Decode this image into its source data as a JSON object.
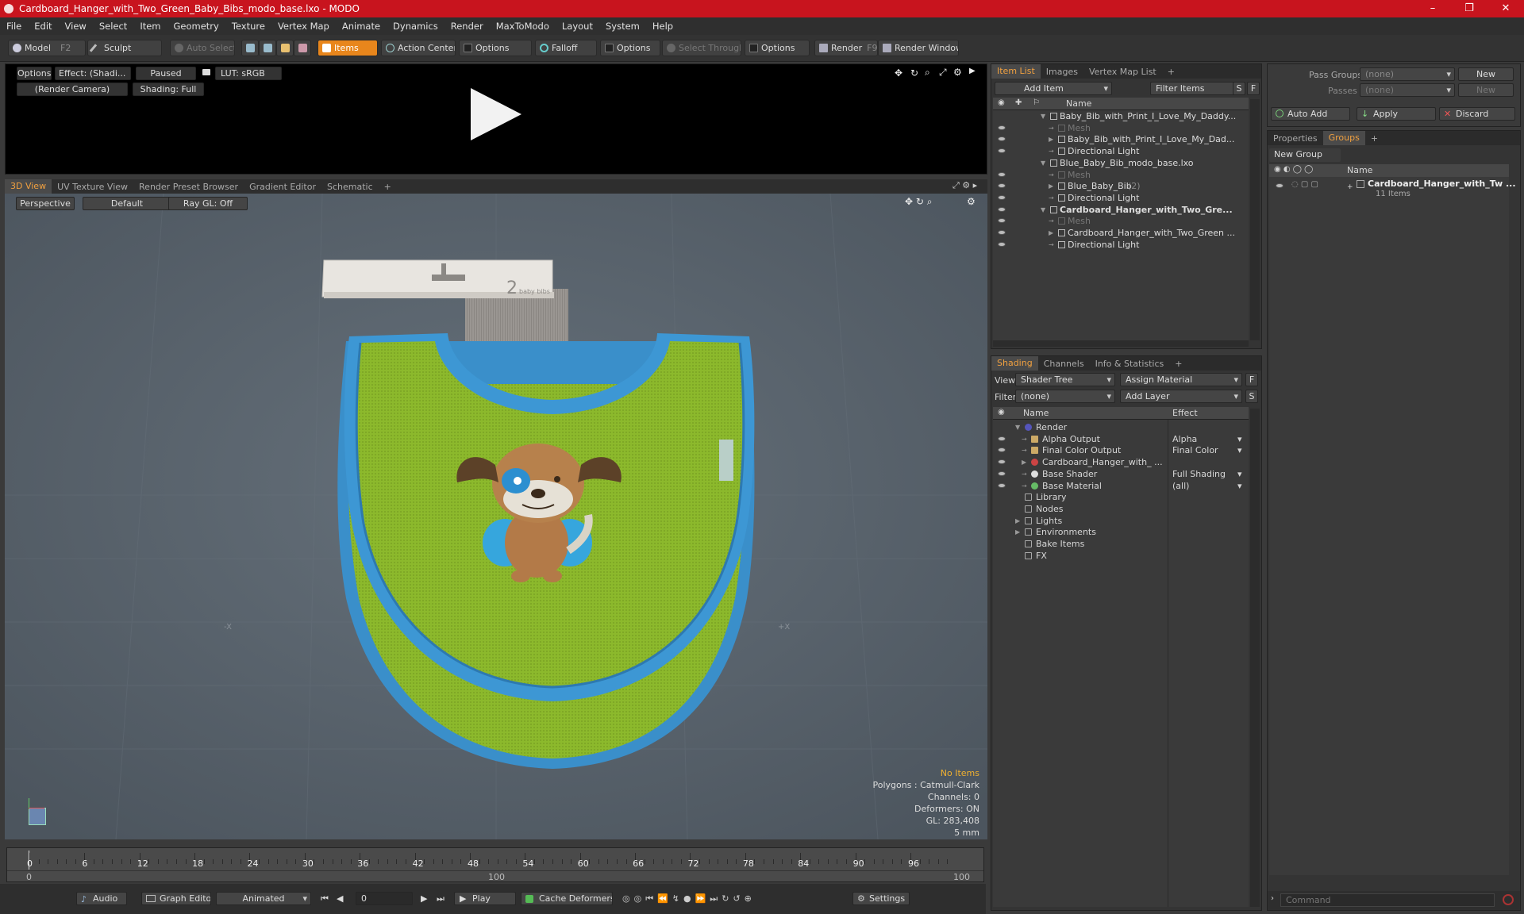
{
  "window": {
    "title": "Cardboard_Hanger_with_Two_Green_Baby_Bibs_modo_base.lxo - MODO",
    "min": "–",
    "max": "❐",
    "close": "✕"
  },
  "menu": [
    "File",
    "Edit",
    "View",
    "Select",
    "Item",
    "Geometry",
    "Texture",
    "Vertex Map",
    "Animate",
    "Dynamics",
    "Render",
    "MaxToModo",
    "Layout",
    "System",
    "Help"
  ],
  "toolbar": {
    "model": "Model",
    "model_key": "F2",
    "sculpt": "Sculpt",
    "auto_select": "Auto Select",
    "items": "Items",
    "action_center": "Action Center",
    "options1": "Options",
    "falloff": "Falloff",
    "options2": "Options",
    "select_through": "Select Through",
    "options3": "Options",
    "render": "Render",
    "render_key": "F9",
    "render_window": "Render Window"
  },
  "preview": {
    "options": "Options",
    "effect": "Effect: (Shadi...",
    "paused": "Paused",
    "lut": "LUT: sRGB",
    "camera": "(Render Camera)",
    "shading": "Shading: Full"
  },
  "viewport_tabs": [
    "3D View",
    "UV Texture View",
    "Render Preset Browser",
    "Gradient Editor",
    "Schematic",
    "+"
  ],
  "viewport": {
    "perspective": "Perspective",
    "default": "Default",
    "raygl": "Ray GL: Off",
    "hanger_text_num": "2",
    "hanger_text": "baby bibs",
    "axis_neg": "-X",
    "axis_pos": "+X",
    "info": {
      "no_items": "No Items",
      "polygons": "Polygons : Catmull-Clark",
      "channels": "Channels: 0",
      "deformers": "Deformers: ON",
      "gl": "GL: 283,408",
      "scale": "5 mm"
    }
  },
  "timeline": {
    "ticks": [
      "0",
      "6",
      "12",
      "18",
      "24",
      "30",
      "36",
      "42",
      "48",
      "54",
      "60",
      "66",
      "72",
      "78",
      "84",
      "90",
      "96"
    ],
    "sub_left": "0",
    "sub_mid": "100",
    "sub_right": "100"
  },
  "bottom": {
    "audio": "Audio",
    "graph_editor": "Graph Editor",
    "animated": "Animated",
    "frame": "0",
    "play": "Play",
    "cache": "Cache Deformers",
    "settings": "Settings"
  },
  "itemlist": {
    "tabs": [
      "Item List",
      "Images",
      "Vertex Map List",
      "+"
    ],
    "add_item": "Add Item",
    "filter_items": "Filter Items",
    "s": "S",
    "f": "F",
    "col_name": "Name",
    "rows": [
      {
        "label": "Baby_Bib_with_Print_I_Love_My_Daddy...",
        "bold": false,
        "dim": false,
        "indent": 0,
        "arrow": "▼"
      },
      {
        "label": "Mesh",
        "bold": false,
        "dim": true,
        "indent": 1,
        "arrow": ""
      },
      {
        "label": "Baby_Bib_with_Print_I_Love_My_Dad...",
        "bold": false,
        "dim": false,
        "indent": 1,
        "arrow": "▶"
      },
      {
        "label": "Directional Light",
        "bold": false,
        "dim": false,
        "indent": 1,
        "arrow": ""
      },
      {
        "label": "Blue_Baby_Bib_modo_base.lxo",
        "bold": false,
        "dim": false,
        "indent": 0,
        "arrow": "▼"
      },
      {
        "label": "Mesh",
        "bold": false,
        "dim": true,
        "indent": 1,
        "arrow": ""
      },
      {
        "label": "Blue_Baby_Bib",
        "suffix": "(2)",
        "bold": false,
        "dim": false,
        "indent": 1,
        "arrow": "▶"
      },
      {
        "label": "Directional Light",
        "bold": false,
        "dim": false,
        "indent": 1,
        "arrow": ""
      },
      {
        "label": "Cardboard_Hanger_with_Two_Gre...",
        "bold": true,
        "dim": false,
        "indent": 0,
        "arrow": "▼"
      },
      {
        "label": "Mesh",
        "bold": false,
        "dim": true,
        "indent": 1,
        "arrow": ""
      },
      {
        "label": "Cardboard_Hanger_with_Two_Green ...",
        "bold": false,
        "dim": false,
        "indent": 1,
        "arrow": "▶"
      },
      {
        "label": "Directional Light",
        "bold": false,
        "dim": false,
        "indent": 1,
        "arrow": ""
      }
    ]
  },
  "shading": {
    "tabs": [
      "Shading",
      "Channels",
      "Info & Statistics",
      "+"
    ],
    "view_label": "View",
    "view_value": "Shader Tree",
    "assign_material": "Assign Material",
    "f": "F",
    "filter_label": "Filter",
    "filter_value": "(none)",
    "add_layer": "Add Layer",
    "s": "S",
    "col_name": "Name",
    "col_effect": "Effect",
    "rows": [
      {
        "label": "Render",
        "effect": "",
        "indent": 0,
        "arrow": "▼",
        "eye": false
      },
      {
        "label": "Alpha Output",
        "effect": "Alpha",
        "indent": 1,
        "arrow": "",
        "eye": true
      },
      {
        "label": "Final Color Output",
        "effect": "Final Color",
        "indent": 1,
        "arrow": "",
        "eye": true
      },
      {
        "label": "Cardboard_Hanger_with_ ...",
        "effect": "",
        "indent": 1,
        "arrow": "▶",
        "eye": true
      },
      {
        "label": "Base Shader",
        "effect": "Full Shading",
        "indent": 1,
        "arrow": "",
        "eye": true
      },
      {
        "label": "Base Material",
        "effect": "(all)",
        "indent": 1,
        "arrow": "",
        "eye": true
      },
      {
        "label": "Library",
        "effect": "",
        "indent": 0,
        "arrow": "",
        "eye": false
      },
      {
        "label": "Nodes",
        "effect": "",
        "indent": 0,
        "arrow": "",
        "eye": false
      },
      {
        "label": "Lights",
        "effect": "",
        "indent": 0,
        "arrow": "▶",
        "eye": false
      },
      {
        "label": "Environments",
        "effect": "",
        "indent": 0,
        "arrow": "▶",
        "eye": false
      },
      {
        "label": "Bake Items",
        "effect": "",
        "indent": 0,
        "arrow": "",
        "eye": false
      },
      {
        "label": "FX",
        "effect": "",
        "indent": 0,
        "arrow": "",
        "eye": false
      }
    ]
  },
  "passes": {
    "pass_groups": "Pass Groups",
    "pass_groups_val": "(none)",
    "new": "New",
    "passes": "Passes",
    "passes_val": "(none)",
    "new2": "New",
    "auto_add": "Auto Add",
    "apply": "Apply",
    "discard": "Discard"
  },
  "groups": {
    "tabs": [
      "Properties",
      "Groups",
      "+"
    ],
    "new_group": "New Group",
    "col_name": "Name",
    "item": "Cardboard_Hanger_with_Tw ...",
    "count": "11 Items"
  },
  "command": {
    "placeholder": "Command"
  }
}
